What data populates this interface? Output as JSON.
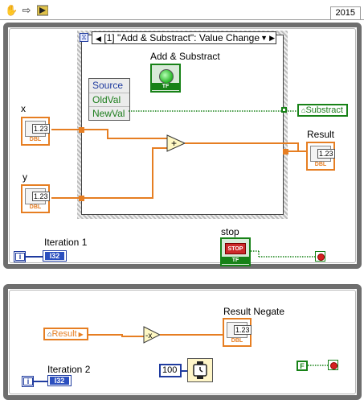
{
  "toolbar": {
    "icons": [
      "hand-icon",
      "arrow-icon",
      "run-icon"
    ]
  },
  "version": "2015",
  "event_structure": {
    "selector": "[1] \"Add & Substract\": Value Change",
    "event_data_node": [
      "Source",
      "OldVal",
      "NewVal"
    ]
  },
  "controls": {
    "add_substract_label": "Add & Substract",
    "x_label": "x",
    "y_label": "y",
    "numeric_text": "1.23",
    "dbl_text": "DBL",
    "tf_text": "TF",
    "stop_label": "stop",
    "stop_text": "STOP"
  },
  "indicators": {
    "result_label": "Result",
    "result_negate_label": "Result Negate"
  },
  "local_vars": {
    "substract_ref": "Substract",
    "result_ref": "Result"
  },
  "loop1": {
    "iteration_label": "Iteration 1",
    "i_text": "i",
    "i32_text": "I32"
  },
  "loop2": {
    "iteration_label": "Iteration 2",
    "i_text": "i",
    "i32_text": "I32",
    "wait_constant": "100",
    "false_constant": "F"
  },
  "colors": {
    "dbl_orange": "#e67e22",
    "bool_green": "#178217",
    "i32_blue": "#1f3b9f",
    "loop_gray": "#6e6e6e"
  }
}
